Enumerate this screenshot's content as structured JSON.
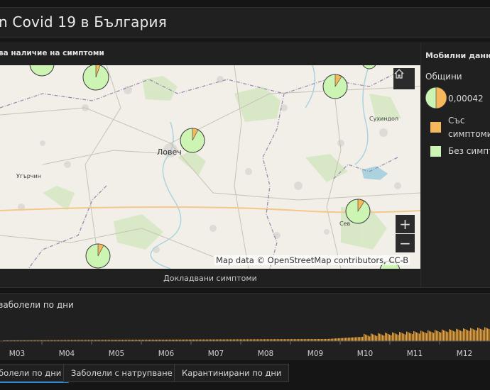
{
  "header": {
    "title": "n Covid 19 в България"
  },
  "map_panel": {
    "title": "ва наличие на симптоми",
    "caption": "Докладвани симптоми",
    "attribution": "Map data © OpenStreetMap contributors, CC-B",
    "zoom_in": "+",
    "zoom_out": "−",
    "places": [
      "Ловеч",
      "Угърчин",
      "Сухиндол",
      "Сев"
    ],
    "icons": [
      "home-icon"
    ]
  },
  "legend": {
    "title": "Мобилни данни",
    "subtitle": "Общини",
    "value": "0,00042",
    "with_symptoms": "Със симптоми",
    "without_symptoms": "Без симптоми",
    "colors": {
      "with": "#f5b85c",
      "without": "#ccf5b4"
    }
  },
  "chart": {
    "title": "заболели по дни",
    "months": [
      "M03",
      "M04",
      "M05",
      "M06",
      "M07",
      "M08",
      "M09",
      "M10",
      "M11",
      "M12"
    ],
    "bar_color": "#e8a33d"
  },
  "tabs": [
    "болели по дни",
    "Заболели с натрупване",
    "Карантинирани по дни"
  ]
}
